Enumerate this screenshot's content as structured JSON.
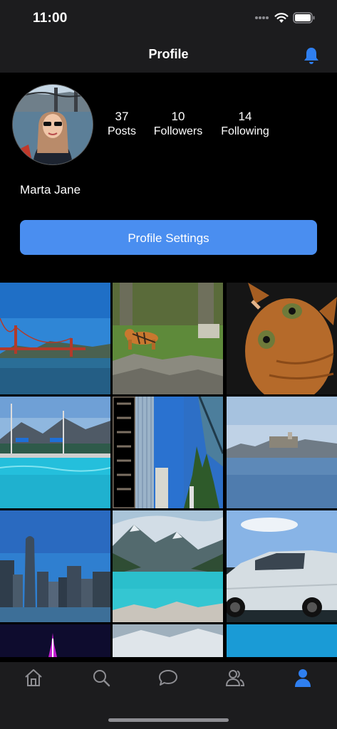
{
  "status_bar": {
    "time": "11:00"
  },
  "nav": {
    "title": "Profile"
  },
  "profile": {
    "name": "Marta Jane",
    "stats": [
      {
        "value": "37",
        "label": "Posts"
      },
      {
        "value": "10",
        "label": "Followers"
      },
      {
        "value": "14",
        "label": "Following"
      }
    ],
    "settings_button": "Profile Settings"
  },
  "grid_photos": [
    "golden-gate-bridge",
    "tiger-in-zoo",
    "orange-cat",
    "swimming-pool",
    "skyscrapers",
    "alcatraz-island",
    "city-skyline",
    "mountain-lake",
    "white-sports-car",
    "purple-tower-night",
    "snowy-mountains",
    "blue-water"
  ],
  "tab_bar": {
    "items": [
      {
        "icon": "home-icon",
        "active": false
      },
      {
        "icon": "search-icon",
        "active": false
      },
      {
        "icon": "chat-bubble-icon",
        "active": false
      },
      {
        "icon": "people-icon",
        "active": false
      },
      {
        "icon": "person-icon",
        "active": true
      }
    ],
    "active_color": "#2f7ff0",
    "inactive_color": "#8e8e93"
  },
  "colors": {
    "accent": "#4a8ef0",
    "background": "#000000",
    "bar": "#1c1c1e"
  }
}
